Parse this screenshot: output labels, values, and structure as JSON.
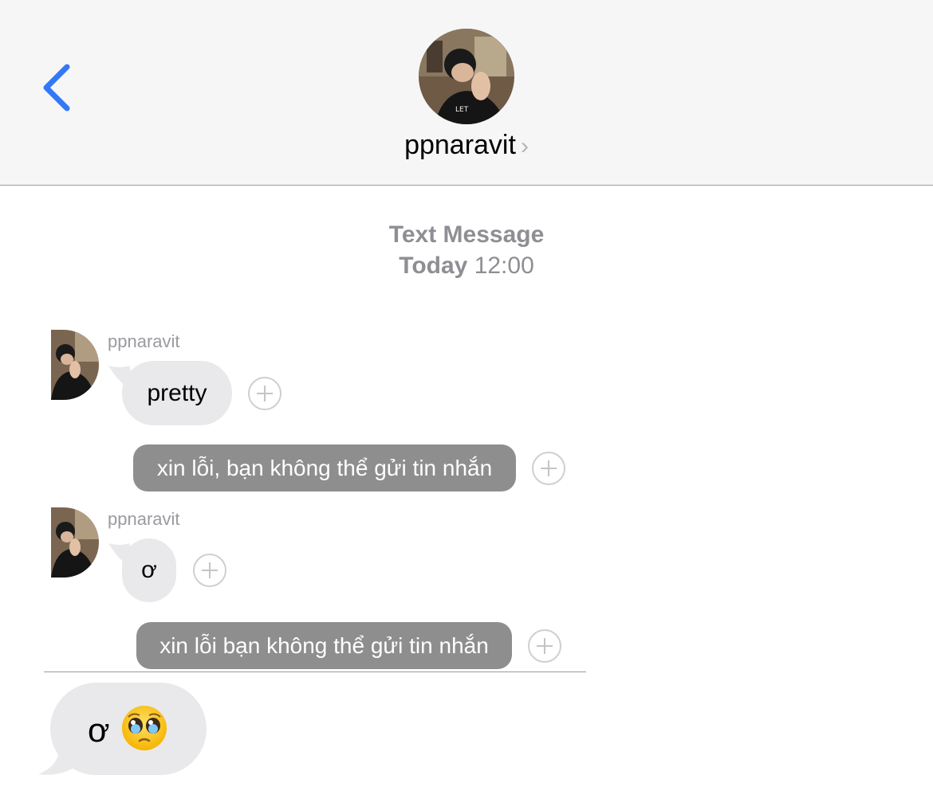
{
  "header": {
    "contact_name": "ppnaravit",
    "chevron": "›",
    "back_icon": "chevron-left-icon"
  },
  "conversation_meta": {
    "service": "Text Message",
    "day": "Today",
    "time": "12:00"
  },
  "messages": [
    {
      "sender": "ppnaravit",
      "text": "pretty"
    },
    {
      "text": "xin lỗi, bạn không thể gửi tin nhắn"
    },
    {
      "sender": "ppnaravit",
      "text": "ơ"
    },
    {
      "text": "xin lỗi bạn không thể gửi tin nhắn"
    },
    {
      "text": "ơ",
      "emoji": "pleading-face-emoji"
    }
  ],
  "colors": {
    "accent": "#3478f6",
    "incoming_bubble": "#e9e9eb",
    "notice_bubble": "#8e8e8e",
    "meta_text": "#8e8e93"
  }
}
